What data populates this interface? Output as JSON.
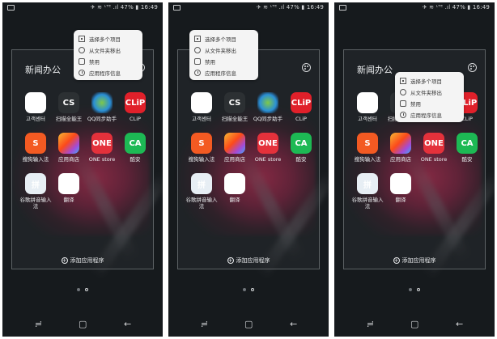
{
  "status_bar": {
    "text": "✈ ≋ ᴸᵀᴱ .ıl 47% ▮ 16:49"
  },
  "folder": {
    "title": "新闻办公",
    "apps": [
      {
        "label": "고객센터",
        "icon": "kt-icon",
        "glyph": "kt"
      },
      {
        "label": "扫描全能王",
        "icon": "camscanner-icon",
        "glyph": "CS"
      },
      {
        "label": "QQ同步助手",
        "icon": "qq-sync-icon",
        "glyph": ""
      },
      {
        "label": "CLiP",
        "icon": "clip-icon",
        "glyph": "CLiP"
      },
      {
        "label": "搜狗输入法",
        "icon": "sogou-icon",
        "glyph": "S"
      },
      {
        "label": "应用商店",
        "icon": "app-store-icon",
        "glyph": ""
      },
      {
        "label": "ONE store",
        "icon": "one-store-icon",
        "glyph": "ONE"
      },
      {
        "label": "酷安",
        "icon": "coolapk-icon",
        "glyph": "CA"
      },
      {
        "label": "谷歌拼音输入法",
        "icon": "google-pinyin-icon",
        "glyph": "拼"
      },
      {
        "label": "翻译",
        "icon": "google-translate-icon",
        "glyph": "G"
      }
    ],
    "add_label": "添加应用程序"
  },
  "context_menu": {
    "items": [
      {
        "label": "选择多个项目",
        "icon": "select-multiple-icon"
      },
      {
        "label": "从文件夹移出",
        "icon": "remove-from-folder-icon"
      },
      {
        "label": "禁用",
        "icon": "disable-icon"
      },
      {
        "label": "应用程序信息",
        "icon": "app-info-icon"
      }
    ]
  },
  "colors": {
    "background": "#161a1d",
    "folder_border": "#5d6265",
    "menu_background": "#f4f4f4",
    "glow": "#ff285f"
  },
  "nav_bar": {
    "recent_icon": "≓",
    "home_icon": "▢",
    "back_icon": "←"
  }
}
